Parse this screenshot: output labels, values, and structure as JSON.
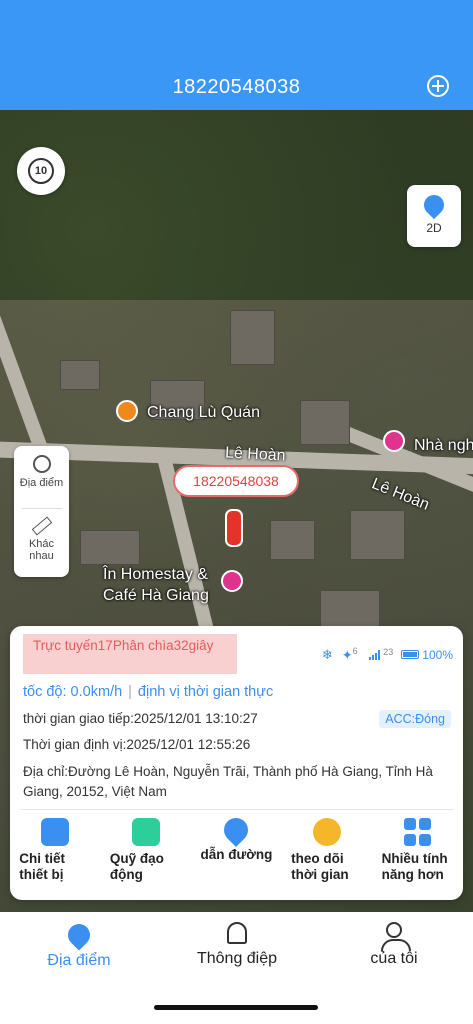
{
  "header": {
    "title": "18220548038"
  },
  "map": {
    "replay_label": "10",
    "view_mode": "2D",
    "labels": {
      "restaurant": "Chang Lù Quán",
      "street_1": "Lê Hoàn",
      "street_2": "Lê Hoàn",
      "guesthouse": "Nhà ngh",
      "homestay_line1": "În Homestay &",
      "homestay_line2": "Café Hà Giang"
    },
    "tools": {
      "location": "Địa điểm",
      "measure_line1": "Khác",
      "measure_line2": "nhau"
    },
    "marker_label": "18220548038"
  },
  "info": {
    "status": "Trực tuyến17Phân chìa32giây",
    "gps_count": "6",
    "signal_count": "23",
    "battery": "100%",
    "speed": "tốc độ: 0.0km/h",
    "positioning": "định vị thời gian thực",
    "comm_time": "thời gian giao tiếp:2025/12/01 13:10:27",
    "acc": "ACC:Đóng",
    "locate_time": "Thời gian định vị:2025/12/01 12:55:26",
    "address": "Địa chỉ:Đường Lê Hoàn, Nguyễn Trãi, Thành phố Hà Giang, Tỉnh Hà Giang, 20152, Việt Nam"
  },
  "actions": [
    {
      "line1": "Chi tiết",
      "line2": "thiết bị"
    },
    {
      "line1": "Quỹ đạo",
      "line2": "động"
    },
    {
      "line1": "dẫn đường",
      "line2": ""
    },
    {
      "line1": "theo dõi",
      "line2": "thời gian"
    },
    {
      "line1": "Nhiều tính",
      "line2": "năng hơn"
    }
  ],
  "tabs": {
    "location": "Địa điểm",
    "messages": "Thông điệp",
    "mine": "của tôi"
  },
  "colors": {
    "primary": "#3b97f5",
    "status_bg": "#f8d0d0",
    "status_text": "#e25d5d"
  }
}
